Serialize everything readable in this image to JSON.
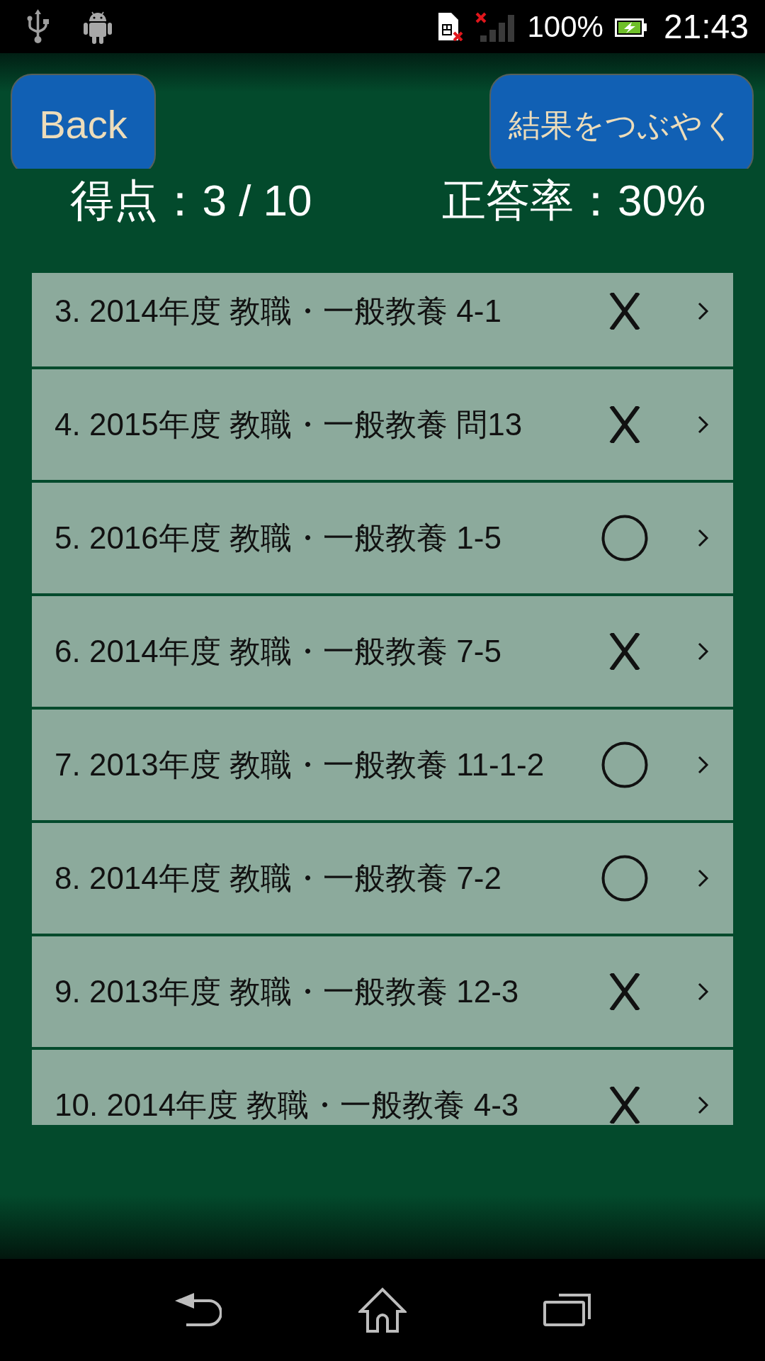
{
  "status_bar": {
    "battery_percent": "100%",
    "time": "21:43"
  },
  "header": {
    "back_button": "Back",
    "share_button": "結果をつぶやく"
  },
  "summary": {
    "score": "得点：3 / 10",
    "accuracy": "正答率：30%"
  },
  "results": [
    {
      "title": "3. 2014年度 教職・一般教養 4-1",
      "correct": false
    },
    {
      "title": "4. 2015年度 教職・一般教養 問13",
      "correct": false
    },
    {
      "title": "5. 2016年度 教職・一般教養 1-5",
      "correct": true
    },
    {
      "title": "6. 2014年度 教職・一般教養 7-5",
      "correct": false
    },
    {
      "title": "7. 2013年度 教職・一般教養 11-1-2",
      "correct": true
    },
    {
      "title": "8. 2014年度 教職・一般教養 7-2",
      "correct": true
    },
    {
      "title": "9. 2013年度 教職・一般教養 12-3",
      "correct": false
    },
    {
      "title": "10. 2014年度 教職・一般教養 4-3",
      "correct": false
    }
  ]
}
